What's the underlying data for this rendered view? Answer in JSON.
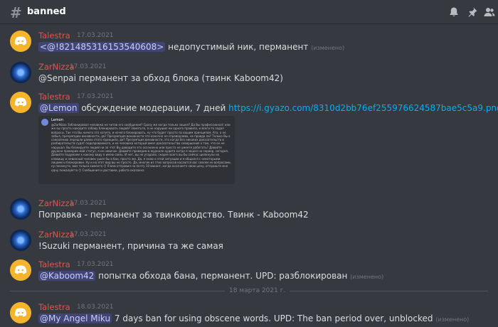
{
  "channel": {
    "name": "banned"
  },
  "header_icons": [
    "bell-icon",
    "pin-icon",
    "members-icon"
  ],
  "messages": [
    {
      "author": "Talestra",
      "time": "17.03.2021",
      "avatar": "discord",
      "mention": "<@!821485316153540608>",
      "text": " недопустимый ник, перманент",
      "edited": "(изменено)"
    },
    {
      "author": "ZarNizza",
      "time": "17.03.2021",
      "avatar": "zar",
      "text": "@Senpai перманент за обход блока (твинк Kaboom42)"
    },
    {
      "author": "Talestra",
      "time": "17.03.2021",
      "avatar": "discord",
      "mention": "@Lemon",
      "text": " обсуждение модерации, 7 дней ",
      "link": "https://i.gyazo.com/8310d2bb76ef255976624587bae5c5a9.png",
      "embed": {
        "name": "Lemon",
        "text": "@ZarNizza Заблокировал человека не читав его сообщения? Сразу же когда только зашел? Да Вы профессионал! или же вы просто находите забаву блокировать людей? Заметьте, я не нарушил ни одного правила, и всего-то задал вопросы. Так что Вы ничего это хотите, и нечего блокировать, ну что будет просто по вашим принципам. Ага, а не забыл, презумпцию виновности, да? Презумпция виновности это конечно не справедливо, не правда ли? Только Вы к сожалению перешли рамки этого принципа, да? Презумпция виновности, это когда без никаких доказательств и разбирательств судят подозреваемого, и не человека который имел доказательства совершения о том, что он не нарушал. Вы блокируете людей ни за что! Вы доводите это осознанно или просто не умеете работать? Давайте дружно проверим мой статус, я не новичок. Давайте проверим в журнале аудита когда я зашел на сервер, сегодня. Давайте подумаем к какому виду я имею связь. И нет, вы не угадали, скорее всего вы бы сейчас щелкнули на клавишу и невинный человек ушел бы в бан, просто же. Да, я знаю о этой ситуации и я общался с некоторыми лицами и блокировки. Ну и на этот вид вы не просто. Да, многие из этих вопросов касаются вас совсем не вопросами, ну покажуте, вам только камента 😊 Я вам отправил на почту 10 вакант, когда осознаете свою цену, отправьте мне одну пожалуйста 😊 Сообщения и доставки, работа оказанна"
      }
    },
    {
      "author": "ZarNizza",
      "time": "17.03.2021",
      "avatar": "zar",
      "text": "Поправка - перманент за твинководство. Твинк - Kaboom42"
    },
    {
      "author": "ZarNizza",
      "time": "17.03.2021",
      "avatar": "zar",
      "text": "!Suzuki перманент, причина та же самая"
    },
    {
      "author": "Talestra",
      "time": "17.03.2021",
      "avatar": "discord",
      "mention": "@Kaboom42",
      "text": " попытка обхода бана, перманент. UPD: разблокирован",
      "edited": "(изменено)"
    },
    {
      "author": "Talestra",
      "time": "18.03.2021",
      "avatar": "discord",
      "mention": "@My Angel Miku",
      "text": " 7 days ban for using obscene words. UPD: The ban period over, unblocked",
      "edited": "(изменено)"
    }
  ],
  "date_divider": "18 марта 2021 г.",
  "colors": {
    "background": "#36393f",
    "author": "#e0554f",
    "mention_bg": "#4f5ba3",
    "link": "#00b0f4"
  }
}
